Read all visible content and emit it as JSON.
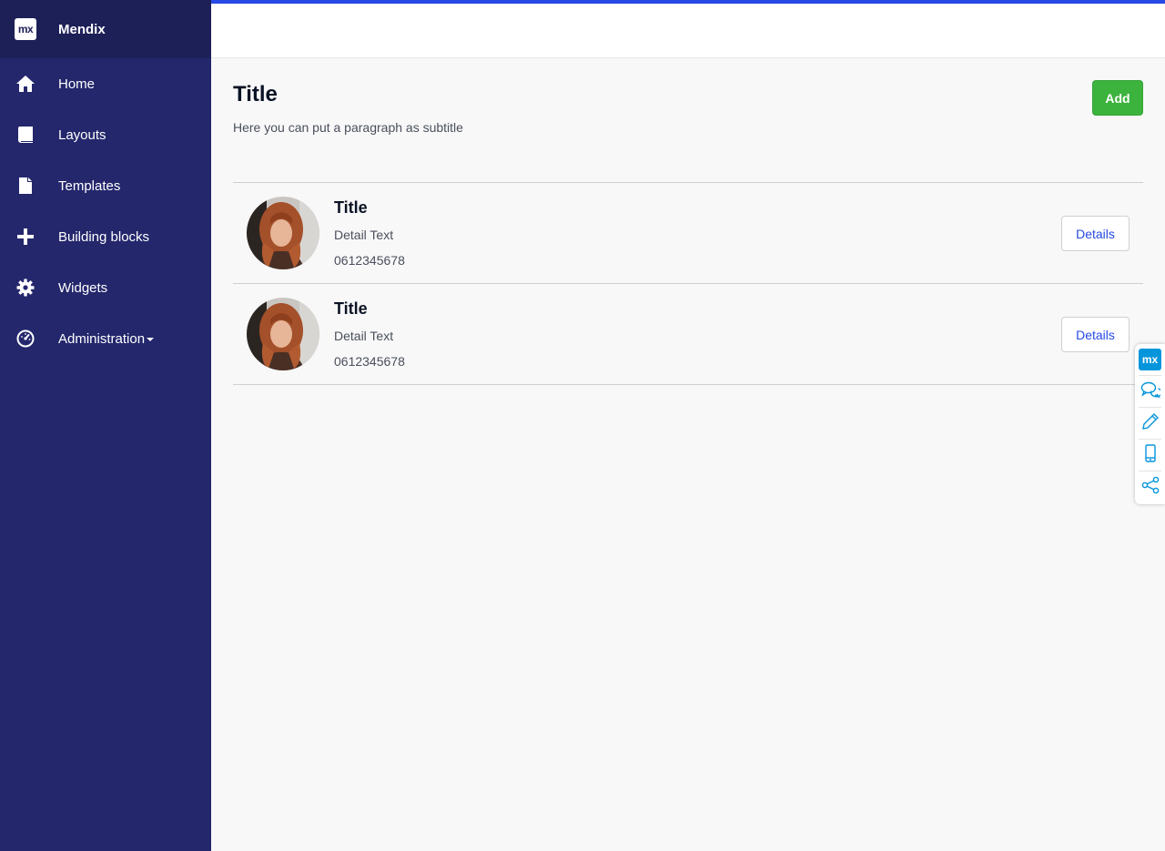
{
  "brand": {
    "logo_text": "mx",
    "name": "Mendix"
  },
  "nav": {
    "items": [
      {
        "label": "Home",
        "icon": "home-icon"
      },
      {
        "label": "Layouts",
        "icon": "book-icon"
      },
      {
        "label": "Templates",
        "icon": "file-icon"
      },
      {
        "label": "Building blocks",
        "icon": "plus-icon"
      },
      {
        "label": "Widgets",
        "icon": "gear-icon"
      },
      {
        "label": "Administration",
        "icon": "dashboard-icon"
      }
    ]
  },
  "page": {
    "title": "Title",
    "subtitle": "Here you can put a paragraph as subtitle",
    "add_label": "Add"
  },
  "list": {
    "rows": [
      {
        "title": "Title",
        "detail": "Detail Text",
        "phone": "0612345678",
        "button": "Details"
      },
      {
        "title": "Title",
        "detail": "Detail Text",
        "phone": "0612345678",
        "button": "Details"
      }
    ]
  },
  "toolpanel": {
    "logo_text": "mx"
  },
  "colors": {
    "sidebar": "#24276c",
    "brand_bar": "#1d1f57",
    "accent": "#264ae5",
    "success": "#3cb33d",
    "tool_accent": "#0595db"
  }
}
